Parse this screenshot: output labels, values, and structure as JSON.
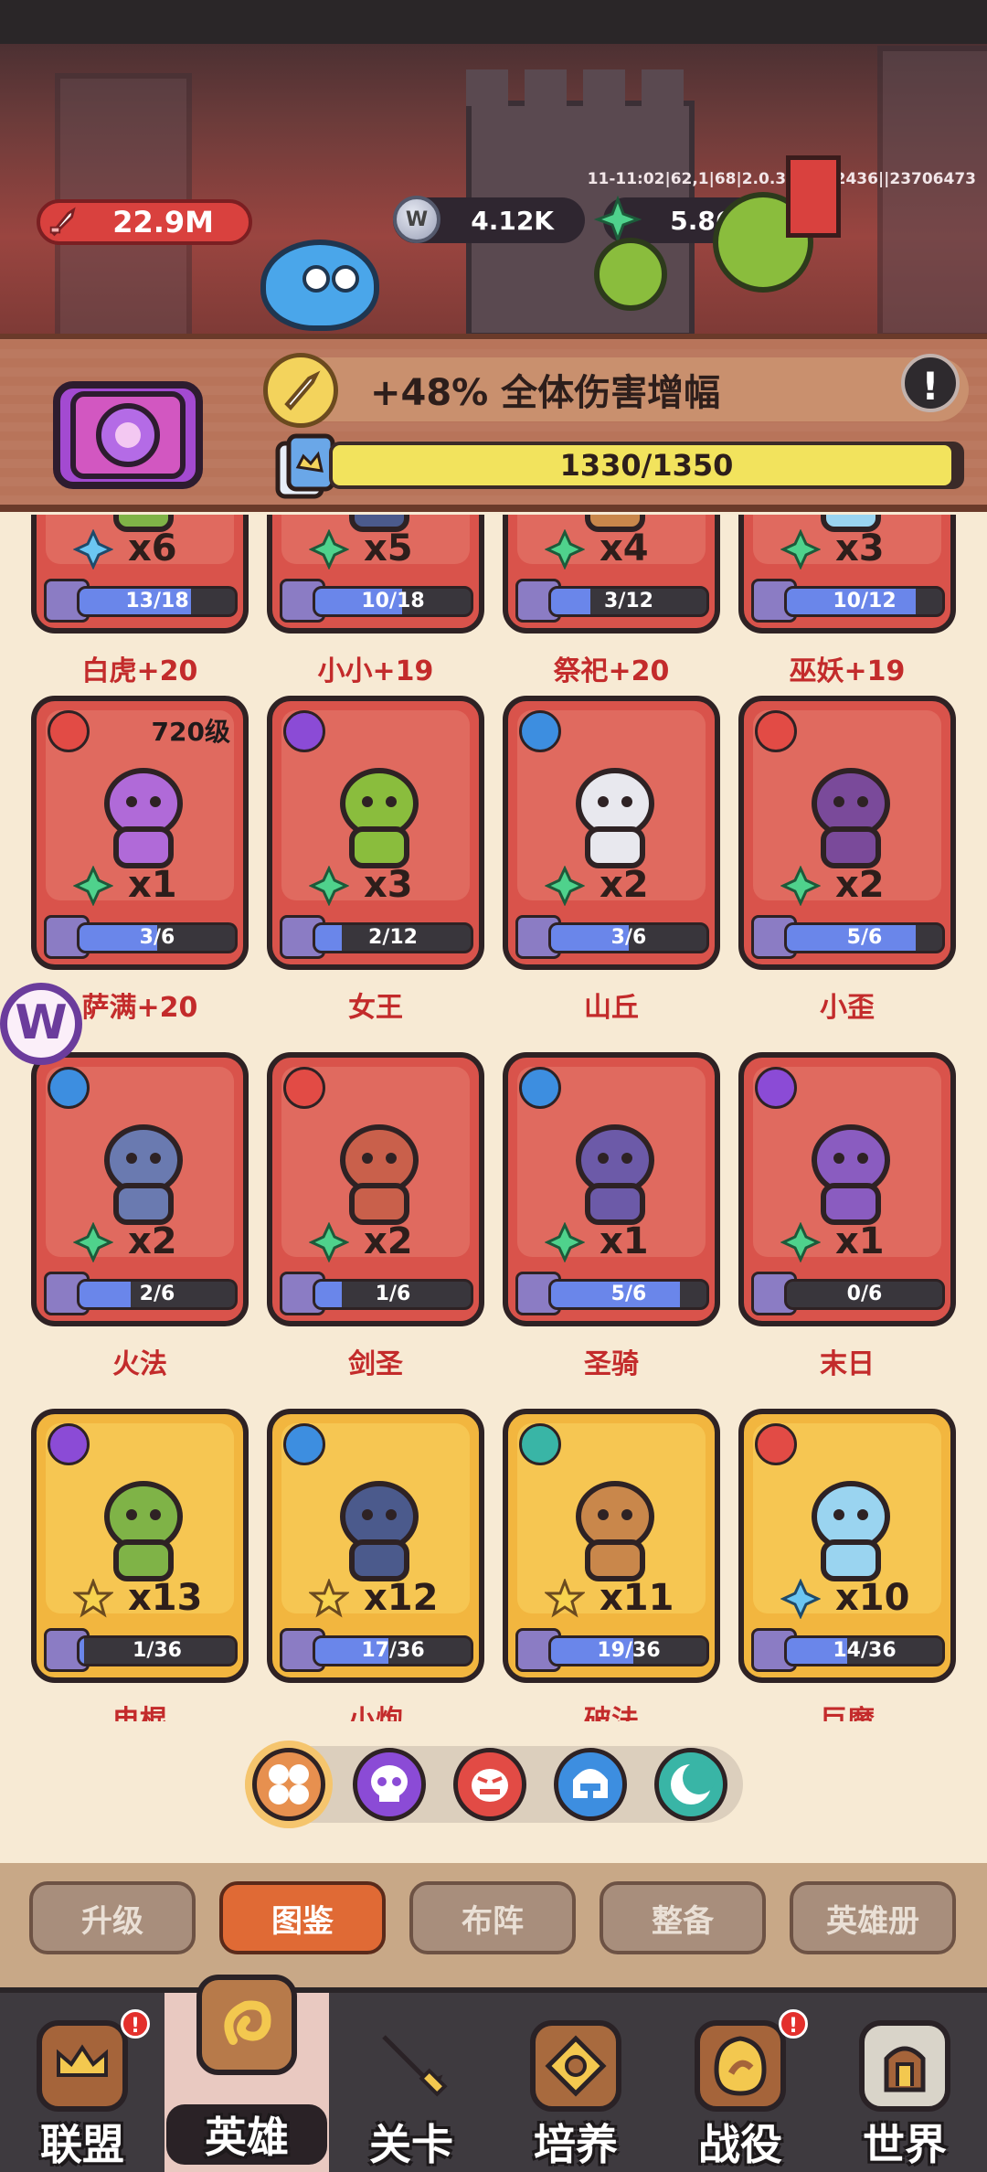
{
  "header": {
    "debug": "11-11:02|62,1|68|2.0.379|452436||23706473",
    "power": "22.9M",
    "silver": "4.12K",
    "gem": "5.86K"
  },
  "bonus": {
    "text": "+48% 全体伤害增幅",
    "progress_text": "1330/1350",
    "progress_ratio": 0.985,
    "alert": "!"
  },
  "heroes": [
    {
      "name": "白虎+20",
      "mark": "diamond-blue",
      "count": "x6",
      "frag": "13/18",
      "ratio": 0.72,
      "color": "red"
    },
    {
      "name": "小小+19",
      "mark": "diamond-green",
      "count": "x5",
      "frag": "10/18",
      "ratio": 0.56,
      "color": "red"
    },
    {
      "name": "祭祀+20",
      "mark": "diamond-green",
      "count": "x4",
      "frag": "3/12",
      "ratio": 0.25,
      "color": "red"
    },
    {
      "name": "巫妖+19",
      "mark": "diamond-green",
      "count": "x3",
      "frag": "10/12",
      "ratio": 0.83,
      "color": "red"
    },
    {
      "name": "萨满+20",
      "mark": "diamond-green",
      "count": "x1",
      "frag": "3/6",
      "ratio": 0.5,
      "color": "red",
      "level": "720级",
      "faction": "red"
    },
    {
      "name": "女王",
      "mark": "diamond-green",
      "count": "x3",
      "frag": "2/12",
      "ratio": 0.17,
      "color": "red",
      "faction": "purple"
    },
    {
      "name": "山丘",
      "mark": "diamond-green",
      "count": "x2",
      "frag": "3/6",
      "ratio": 0.5,
      "color": "red",
      "faction": "blue"
    },
    {
      "name": "小歪",
      "mark": "diamond-green",
      "count": "x2",
      "frag": "5/6",
      "ratio": 0.83,
      "color": "red",
      "faction": "red"
    },
    {
      "name": "火法",
      "mark": "diamond-green",
      "count": "x2",
      "frag": "2/6",
      "ratio": 0.33,
      "color": "red",
      "faction": "blue"
    },
    {
      "name": "剑圣",
      "mark": "diamond-green",
      "count": "x2",
      "frag": "1/6",
      "ratio": 0.17,
      "color": "red",
      "faction": "red"
    },
    {
      "name": "圣骑",
      "mark": "diamond-green",
      "count": "x1",
      "frag": "5/6",
      "ratio": 0.83,
      "color": "red",
      "faction": "blue"
    },
    {
      "name": "末日",
      "mark": "diamond-green",
      "count": "x1",
      "frag": "0/6",
      "ratio": 0.0,
      "color": "red",
      "faction": "purple"
    },
    {
      "name": "电棍",
      "mark": "star",
      "count": "x13",
      "frag": "1/36",
      "ratio": 0.03,
      "color": "gold",
      "faction": "purple"
    },
    {
      "name": "小炮",
      "mark": "star",
      "count": "x12",
      "frag": "17/36",
      "ratio": 0.47,
      "color": "gold",
      "faction": "blue"
    },
    {
      "name": "破法",
      "mark": "star",
      "count": "x11",
      "frag": "19/36",
      "ratio": 0.53,
      "color": "gold",
      "faction": "teal"
    },
    {
      "name": "巨魔",
      "mark": "diamond-blue",
      "count": "x10",
      "frag": "14/36",
      "ratio": 0.39,
      "color": "gold",
      "faction": "red"
    }
  ],
  "side_badge": "W",
  "filters": [
    "all-filter-icon",
    "skull-faction-icon",
    "demon-faction-icon",
    "helmet-faction-icon",
    "moon-faction-icon"
  ],
  "sub_tabs": [
    "升级",
    "图鉴",
    "布阵",
    "整备",
    "英雄册"
  ],
  "active_sub_tab": 1,
  "nav": [
    {
      "label": "联盟",
      "icon": "crown-shield-icon",
      "badge": "!"
    },
    {
      "label": "英雄",
      "icon": "hero-scroll-icon"
    },
    {
      "label": "关卡",
      "icon": "sword-icon"
    },
    {
      "label": "培养",
      "icon": "rune-icon"
    },
    {
      "label": "战役",
      "icon": "campaign-icon",
      "badge": "!"
    },
    {
      "label": "世界",
      "icon": "world-icon"
    }
  ],
  "active_nav": 1,
  "colors": {
    "red": "#d9534b",
    "gold": "#f2b63f",
    "accent": "#e06a35"
  }
}
